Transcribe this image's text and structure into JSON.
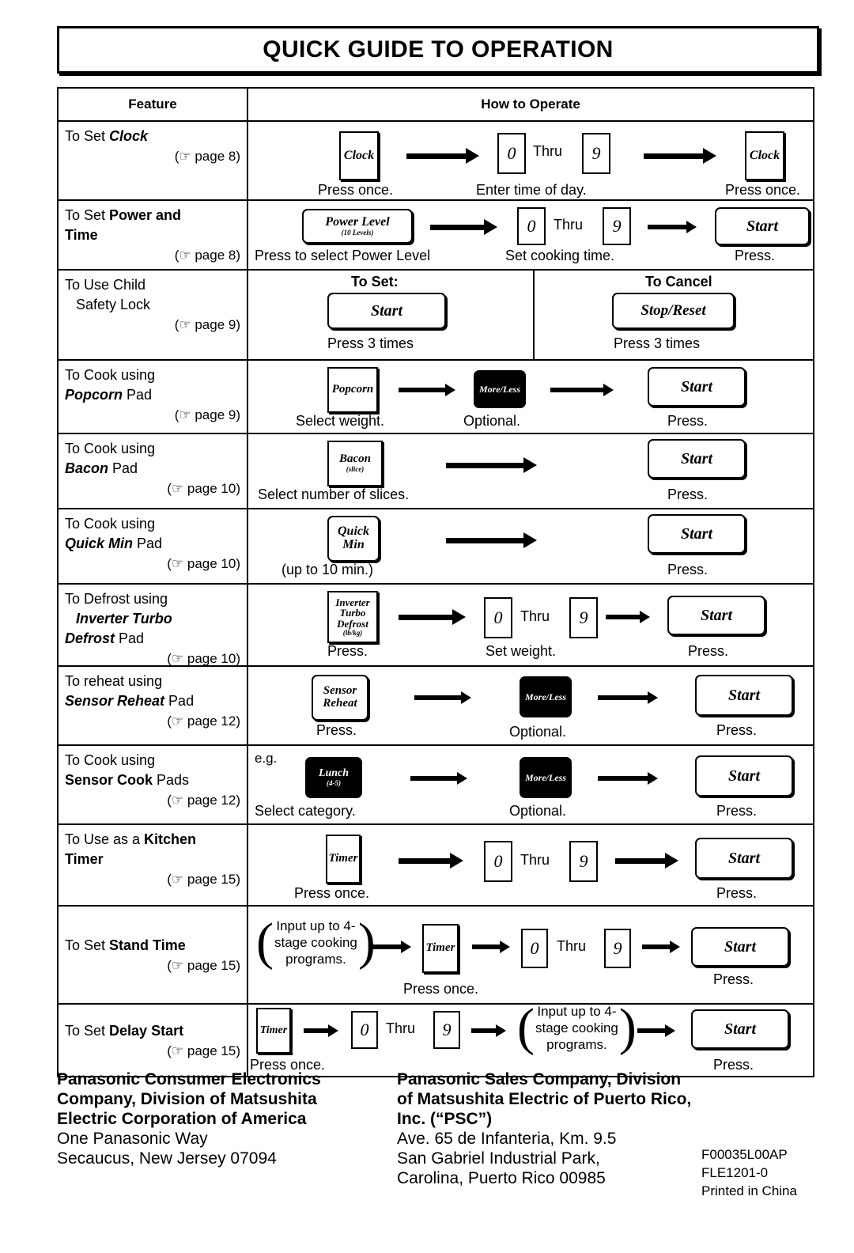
{
  "title": "QUICK GUIDE TO OPERATION",
  "table": {
    "headers": {
      "feature": "Feature",
      "how_to_operate": "How to Operate"
    },
    "rows": [
      {
        "feature": {
          "line1": "To Set ",
          "line1_em": "Clock",
          "pageref": "(☞ page 8)",
          "page": "8"
        },
        "steps": {
          "pad1": "Clock",
          "cap1": "Press once.",
          "digit_from": "0",
          "thru": "Thru",
          "digit_to": "9",
          "cap2": "Enter time of day.",
          "pad2": "Clock",
          "cap3": "Press once."
        }
      },
      {
        "feature": {
          "line1": "To Set ",
          "line1_em": "Power and",
          "line2": "Time",
          "pageref": "(☞ page 8)",
          "page": "8"
        },
        "steps": {
          "pad1": "Power Level",
          "pad1_sub": "(10 Levels)",
          "cap1": "Press to select Power Level",
          "digit_from": "0",
          "thru": "Thru",
          "digit_to": "9",
          "cap2": "Set cooking time.",
          "pad2": "Start",
          "cap3": "Press."
        }
      },
      {
        "feature": {
          "line1": "To Use  Child",
          "line2": "Safety Lock",
          "pageref": "(☞ page 9)",
          "page": "9"
        },
        "steps": {
          "set_label": "To Set:",
          "set_pad": "Start",
          "set_cap": "Press 3 times",
          "cancel_label": "To Cancel",
          "cancel_pad": "Stop/Reset",
          "cancel_cap": "Press 3 times"
        }
      },
      {
        "feature": {
          "line1": "To Cook using",
          "line2_em": "Popcorn",
          "line2_rest": " Pad",
          "pageref": "(☞ page 9)",
          "page": "9"
        },
        "steps": {
          "pad1": "Popcorn",
          "cap1": "Select weight.",
          "pad2": "More/Less",
          "cap2": "Optional.",
          "pad3": "Start",
          "cap3": "Press."
        }
      },
      {
        "feature": {
          "line1": "To Cook using",
          "line2_em": "Bacon",
          "line2_rest": " Pad",
          "pageref": "(☞ page 10)",
          "page": "10"
        },
        "steps": {
          "pad1": "Bacon",
          "pad1_sub": "(slice)",
          "cap1": "Select number of slices.",
          "pad2": "Start",
          "cap2": "Press."
        }
      },
      {
        "feature": {
          "line1": "To Cook using",
          "line2_em": "Quick Min",
          "line2_rest": " Pad",
          "pageref": "(☞ page 10)",
          "page": "10"
        },
        "steps": {
          "pad1_l1": "Quick",
          "pad1_l2": "Min",
          "cap1": "(up to 10 min.)",
          "pad2": "Start",
          "cap2": "Press."
        }
      },
      {
        "feature": {
          "line1": "To Defrost using",
          "line2_em": "Inverter Turbo",
          "line3_em": "Defrost",
          "line3_rest": " Pad",
          "pageref": "(☞ page 10)",
          "page": "10"
        },
        "steps": {
          "pad1_l1": "Inverter",
          "pad1_l2": "Turbo",
          "pad1_l3": "Defrost",
          "pad1_sub": "(lb/kg)",
          "cap1": "Press.",
          "digit_from": "0",
          "thru": "Thru",
          "digit_to": "9",
          "cap2": "Set weight.",
          "pad2": "Start",
          "cap3": "Press."
        }
      },
      {
        "feature": {
          "line1": "To reheat using",
          "line2_em": "Sensor Reheat",
          "line2_rest": " Pad",
          "pageref": "(☞ page 12)",
          "page": "12"
        },
        "steps": {
          "pad1_l1": "Sensor",
          "pad1_l2": "Reheat",
          "cap1": "Press.",
          "pad2": "More/Less",
          "cap2": "Optional.",
          "pad3": "Start",
          "cap3": "Press."
        }
      },
      {
        "feature": {
          "line1": "To Cook using",
          "line2_em": "Sensor Cook",
          "line2_rest": " Pads",
          "pageref": "(☞ page 12)",
          "page": "12"
        },
        "steps": {
          "eg": "e.g.",
          "pad1": "Lunch",
          "pad1_sub": "(4-5)",
          "cap1": "Select category.",
          "pad2": "More/Less",
          "cap2": "Optional.",
          "pad3": "Start",
          "cap3": "Press."
        }
      },
      {
        "feature": {
          "line1": "To Use as a ",
          "line1_em": "Kitchen",
          "line2": "Timer",
          "pageref": "(☞ page 15)",
          "page": "15"
        },
        "steps": {
          "pad1": "Timer",
          "cap1": "Press once.",
          "digit_from": "0",
          "thru": "Thru",
          "digit_to": "9",
          "pad2": "Start",
          "cap3": "Press."
        }
      },
      {
        "feature": {
          "line1": "To Set ",
          "line1_em": "Stand Time",
          "pageref": "(☞ page 15)",
          "page": "15"
        },
        "steps": {
          "blob_l1": "Input up to 4-",
          "blob_l2": "stage cooking",
          "blob_l3": "programs.",
          "pad1": "Timer",
          "cap1": "Press once.",
          "digit_from": "0",
          "thru": "Thru",
          "digit_to": "9",
          "pad2": "Start",
          "cap3": "Press."
        }
      },
      {
        "feature": {
          "line1": "To Set ",
          "line1_em": "Delay Start",
          "pageref": "(☞ page 15)",
          "page": "15"
        },
        "steps": {
          "pad1": "Timer",
          "cap1": "Press once.",
          "digit_from": "0",
          "thru": "Thru",
          "digit_to": "9",
          "blob_l1": "Input up to 4-",
          "blob_l2": "stage cooking",
          "blob_l3": "programs.",
          "pad2": "Start",
          "cap3": "Press."
        }
      }
    ]
  },
  "footer": {
    "left": {
      "l1": "Panasonic Consumer Electronics",
      "l2": "Company, Division of Matsushita",
      "l3": "Electric Corporation of America",
      "l4": "One Panasonic Way",
      "l5": "Secaucus, New Jersey 07094"
    },
    "right": {
      "l1": "Panasonic Sales Company, Division",
      "l2": "of Matsushita Electric of Puerto Rico,",
      "l3": "Inc. (“PSC”)",
      "l4": "Ave. 65 de Infanteria, Km. 9.5",
      "l5": "San Gabriel Industrial Park,",
      "l6": "Carolina, Puerto Rico 00985"
    },
    "codes": {
      "c1": "F00035L00AP",
      "c2": "FLE1201-0",
      "c3": "Printed in China"
    }
  }
}
